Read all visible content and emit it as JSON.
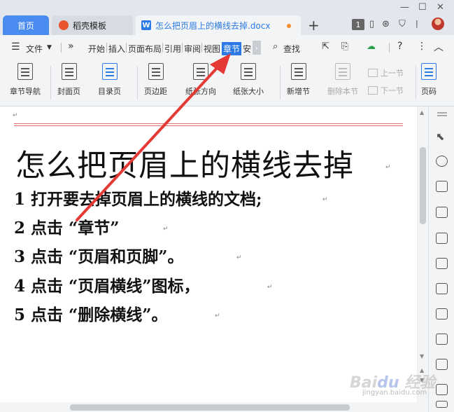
{
  "titlebar": {
    "tabs": [
      {
        "label": "首页"
      },
      {
        "label": "稻壳模板"
      },
      {
        "label": "怎么把页眉上的横线去掉.docx"
      }
    ],
    "badge": "1"
  },
  "menubar": {
    "file": "文件",
    "items": [
      "开始",
      "插入",
      "页面布局",
      "引用",
      "审阅",
      "视图",
      "章节",
      "安"
    ],
    "active": "章节",
    "search": "查找"
  },
  "ribbon": {
    "buttons": [
      {
        "label": "章节导航"
      },
      {
        "label": "封面页"
      },
      {
        "label": "目录页"
      },
      {
        "label": "页边距"
      },
      {
        "label": "纸张方向"
      },
      {
        "label": "纸张大小"
      },
      {
        "label": "新增节"
      },
      {
        "label": "删除本节"
      },
      {
        "label": "页码"
      }
    ],
    "prev_section": "上一节",
    "next_section": "下一节"
  },
  "document": {
    "title": "怎么把页眉上的横线去掉",
    "steps": [
      "1 打开要去掉页眉上的横线的文档;",
      "2 点击 “章节”",
      "3 点击 “页眉和页脚”。",
      "4 点击 “页眉横线”图标，",
      "5 点击 “删除横线”。"
    ]
  },
  "colors": {
    "accent": "#2c7be5",
    "home_tab": "#4a8bf0",
    "annotation_arrow": "#e53935",
    "header_line": "#e07070"
  }
}
